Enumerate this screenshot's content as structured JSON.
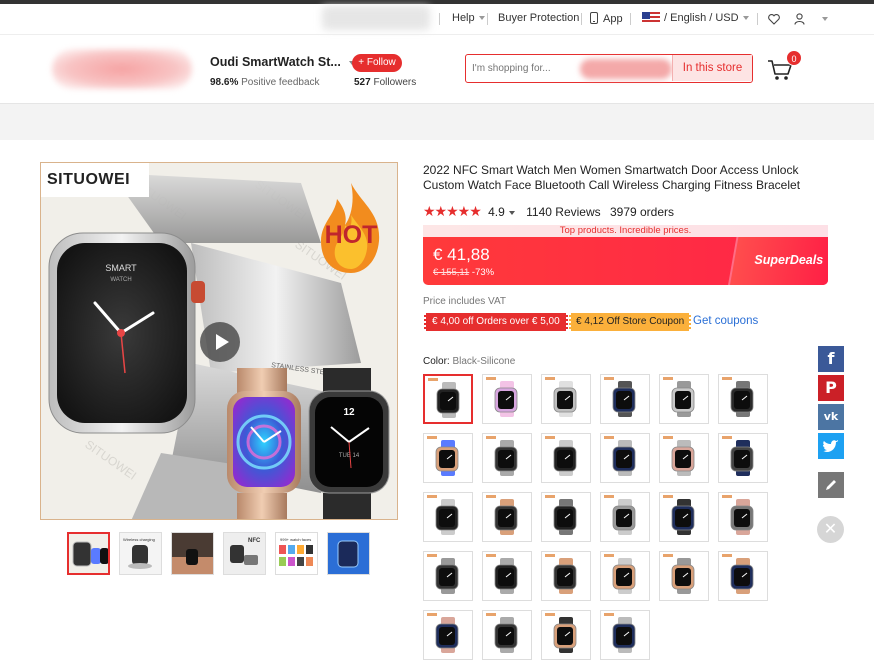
{
  "topnav": {
    "help": "Help",
    "buyer_protection": "Buyer Protection",
    "app": "App",
    "lang_currency": "/ English / USD"
  },
  "store": {
    "name": "Oudi SmartWatch St...",
    "feedback_pct": "98.6%",
    "feedback_label": "Positive feedback",
    "follow_label": "+ Follow",
    "followers_count": "527",
    "followers_label": "Followers",
    "search_placeholder": "I'm shopping for...",
    "in_store_label": "In this store",
    "cart_count": "0"
  },
  "product": {
    "brand_overlay": "SITUOWEI",
    "hot_label": "HOT",
    "watch_face_text_1": "SMART",
    "watch_face_text_2": "WATCH",
    "band_text": "STAINLESS STEEL",
    "black_watch_time": "12",
    "black_watch_date": "TUE 14",
    "thumb_labels": [
      "",
      "Wireless charging",
      "",
      "NFC",
      "999+ watch faces",
      ""
    ],
    "title": "2022 NFC Smart Watch Men Women Smartwatch Door Access Unlock Custom Watch Face Bluetooth Call Wireless Charging Fitness Bracelet",
    "rating": "4.9",
    "reviews": "1140 Reviews",
    "orders": "3979 orders",
    "deal_strip": "Top products. Incredible prices.",
    "price": "€ 41,88",
    "old_price": "€ 155,11",
    "discount": "-73%",
    "superdeals_label": "SuperDeals",
    "vat_note": "Price includes VAT",
    "coupon_1": "€ 4,00 off Orders over € 5,00",
    "coupon_2": "€ 4,12 Off Store Coupon",
    "get_coupons": "Get coupons",
    "color_label": "Color:",
    "color_value": "Black-Silicone"
  },
  "colors": {
    "accent": "#e62e2e",
    "coupon_orange": "#fbb03b",
    "link_blue": "#2a6fd6"
  },
  "social": [
    "f",
    "P",
    "vk",
    "t",
    "pencil-icon"
  ]
}
